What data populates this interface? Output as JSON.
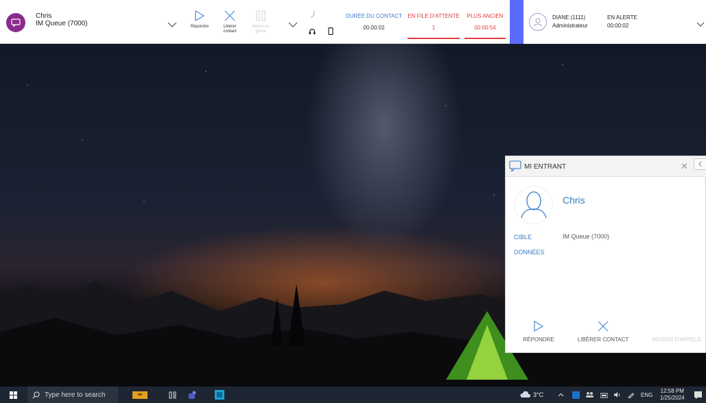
{
  "topbar": {
    "contact_name": "Chris",
    "contact_queue": "IM Queue (7000)",
    "actions": {
      "answer": "Répondre",
      "release_line1": "Libérer",
      "release_line2": "contact",
      "hold_line1": "Mettre en",
      "hold_line2": "garde"
    },
    "stats": {
      "duration_label": "DURÉE DU CONTACT",
      "duration_value": "00:00:02",
      "queue_label": "EN FILE D'ATTENTE",
      "queue_value": "1",
      "oldest_label": "PLUS ANCIEN",
      "oldest_value": "00:00:54"
    },
    "agent": {
      "name": "DIANE (1111)",
      "role": "Administrateur",
      "status_label": "EN ALERTE",
      "status_value": "00:00:02"
    }
  },
  "popup": {
    "title": "MI ENTRANT",
    "contact_name": "Chris",
    "target_label": "CIBLE",
    "target_value": "IM Queue (7000)",
    "data_label": "DONNÉES",
    "answer_label": "RÉPONDRE",
    "release_label": "LIBÉRER CONTACT",
    "forward_label": "RENVOI D'APPELS"
  },
  "taskbar": {
    "search_placeholder": "Type here to search",
    "temperature": "3°C",
    "language": "ENG",
    "time": "12:58 PM",
    "date": "1/25/2024"
  },
  "colors": {
    "accent_blue": "#3a7cc7",
    "alert_red": "#e23b3b",
    "chat_purple": "#8a2c8c",
    "agent_strip": "#5b6bff",
    "taskbar": "#1f2633"
  }
}
